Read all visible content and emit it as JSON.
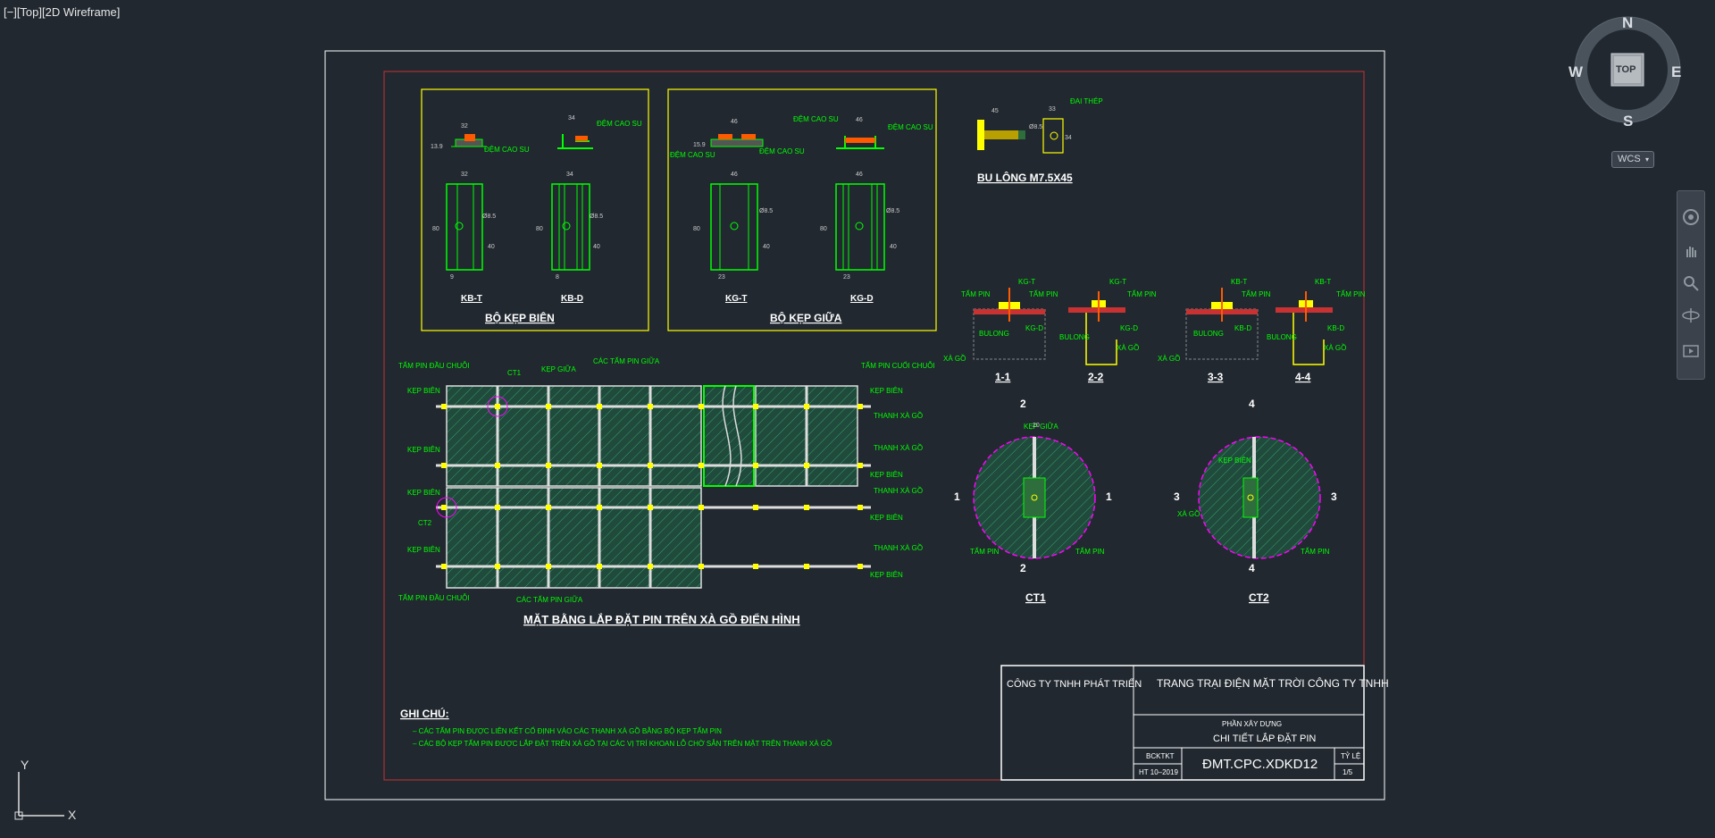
{
  "viewport": {
    "label": "[−][Top][2D Wireframe]"
  },
  "viewcube": {
    "north": "N",
    "south": "S",
    "east": "E",
    "west": "W",
    "face": "TOP",
    "wcs": "WCS"
  },
  "ucs": {
    "x": "X",
    "y": "Y"
  },
  "drawing": {
    "clip_group_edge": {
      "title": "BỘ KẸP BIÊN",
      "left_label": "KB-T",
      "right_label": "KB-D",
      "rubber_pad": "ĐỆM CAO SU",
      "dims": {
        "w32": "32",
        "w34": "34",
        "h13": "13.9",
        "h80": "80",
        "h40": "40",
        "d8": "8",
        "phi": "Ø8.5",
        "w9": "9"
      }
    },
    "clip_group_mid": {
      "title": "BỘ KẸP GIỮA",
      "left_label": "KG-T",
      "right_label": "KG-D",
      "rubber_pad": "ĐỆM CAO SU",
      "dims": {
        "w46": "46",
        "h15": "15.9",
        "h80": "80",
        "h40": "40",
        "w23": "23",
        "phi": "Ø8.5"
      }
    },
    "bolt": {
      "title": "BU LÔNG M7.5X45",
      "washer": "ĐAI THÉP",
      "d45": "45",
      "d33": "33",
      "d34": "34",
      "phi": "Ø8.5"
    },
    "sections": {
      "s11": "1-1",
      "s22": "2-2",
      "s33": "3-3",
      "s44": "4-4",
      "panel": "TẤM PIN",
      "kgt": "KG-T",
      "kgd": "KG-D",
      "kbt": "KB-T",
      "kbd": "KB-D",
      "bulong": "BULONG",
      "xago": "XÀ GỒ"
    },
    "plan": {
      "title": "MẶT BẰNG LẮP ĐẶT PIN TRÊN XÀ GỒ ĐIỂN HÌNH",
      "first_panel": "TẤM PIN ĐẦU CHUỖI",
      "last_panel": "TẤM PIN CUỐI CHUỖI",
      "mid_clip": "KẸP GIỮA",
      "edge_clip": "KẸP BIÊN",
      "between_panels": "CÁC TẤM PIN GIỮA",
      "purlin": "THANH XÀ GỒ",
      "ct1": "CT1",
      "ct2": "CT2"
    },
    "details": {
      "ct1": "CT1",
      "ct2": "CT2",
      "n1": "1",
      "n2": "2",
      "n3": "3",
      "n4": "4",
      "mid_clip": "KẸP GIỮA",
      "edge_clip": "KẸP BIÊN",
      "panel": "TẤM PIN",
      "xago": "XÀ GỒ",
      "d20": "20"
    },
    "notes": {
      "title": "GHI CHÚ:",
      "line1": "– CÁC TẤM PIN ĐƯỢC LIÊN KẾT CỐ ĐỊNH VÀO CÁC THANH XÀ GỒ BẰNG BỘ KẸP TẤM PIN",
      "line2": "– CÁC BỘ KẸP TẤM PIN ĐƯỢC LẮP ĐẶT TRÊN XÀ GỒ TẠI CÁC VỊ TRÍ KHOAN LỖ CHỜ SẴN TRÊN MẶT TRÊN THANH XÀ GỒ"
    },
    "title_block": {
      "company": "CÔNG TY TNHH PHÁT TRIỂN",
      "project": "TRANG TRẠI ĐIỆN MẶT TRỜI CÔNG TY TNHH",
      "part": "PHẦN XÂY DỰNG",
      "sheet_name": "CHI TIẾT LẮP ĐẶT PIN",
      "stage": "BCKTKT",
      "date": "HT 10–2019",
      "code": "ĐMT.CPC.XDKD12",
      "scale_label": "TỶ LỆ",
      "scale": "1/5"
    }
  },
  "colors": {
    "background": "#212830",
    "paper_border": "#ffffff",
    "inner_border": "#c83232",
    "cad_green": "#00ff00",
    "cad_yellow": "#ffff00",
    "cad_magenta": "#ff00ff",
    "hatch": "#2e7d5a"
  }
}
